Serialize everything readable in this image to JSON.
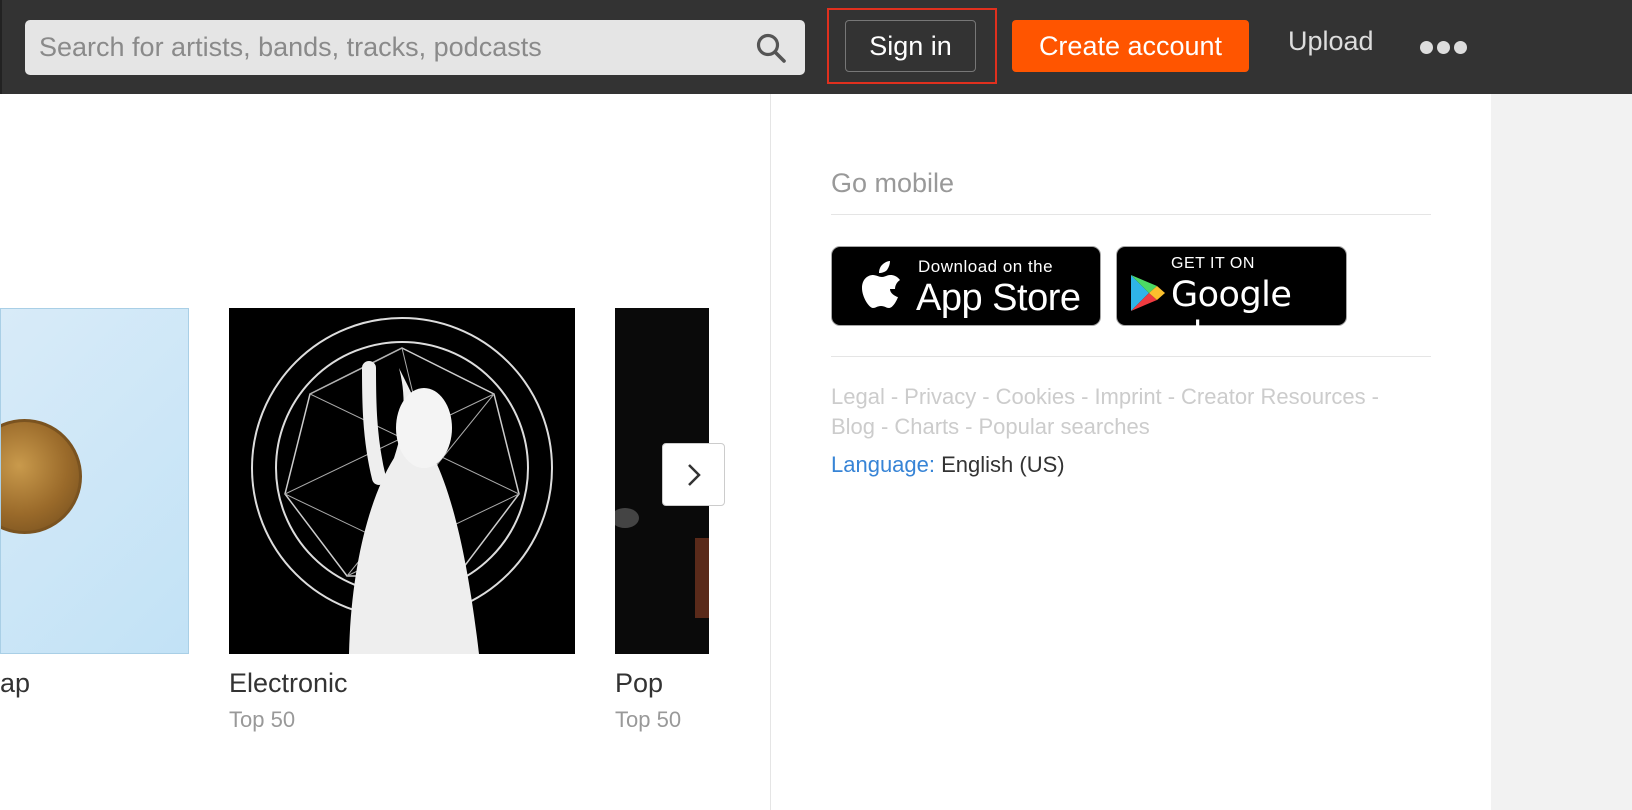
{
  "header": {
    "search_placeholder": "Search for artists, bands, tracks, podcasts",
    "search_icon": "search-icon",
    "signin_label": "Sign in",
    "create_account_label": "Create account",
    "upload_label": "Upload",
    "more_icon": "more-dots-icon",
    "accent_color": "#ff5500"
  },
  "charts": {
    "cards": [
      {
        "title": "ap",
        "subtitle": ""
      },
      {
        "title": "Electronic",
        "subtitle": "Top 50"
      },
      {
        "title": "Pop",
        "subtitle": "Top 50"
      }
    ],
    "next_icon": "chevron-right-icon"
  },
  "sidebar": {
    "go_mobile": "Go mobile",
    "app_store": {
      "small": "Download on the",
      "big": "App Store"
    },
    "google_play": {
      "small": "GET IT ON",
      "big": "Google play"
    },
    "links": [
      "Legal",
      "Privacy",
      "Cookies",
      "Imprint",
      "Creator Resources",
      "Blog",
      "Charts",
      "Popular searches"
    ],
    "language_label": "Language:",
    "language_value": "English (US)"
  }
}
